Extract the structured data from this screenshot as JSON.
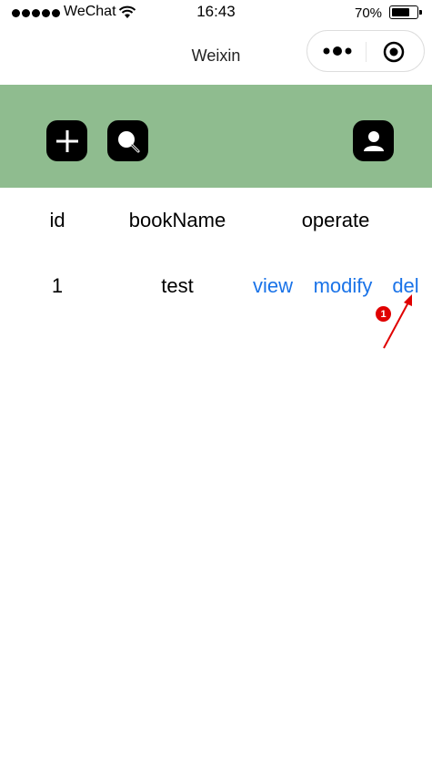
{
  "status_bar": {
    "carrier": "WeChat",
    "time": "16:43",
    "battery_percent": "70%",
    "battery_level": 0.7
  },
  "nav": {
    "title": "Weixin",
    "more_icon": "more-dots-icon",
    "close_icon": "close-miniprogram-icon"
  },
  "toolbar": {
    "background": "#8fbc8f",
    "buttons": [
      {
        "icon": "plus-icon"
      },
      {
        "icon": "search-icon"
      },
      {
        "icon": "user-icon"
      }
    ]
  },
  "table": {
    "headers": [
      "id",
      "bookName",
      "operate"
    ],
    "rows": [
      {
        "id": "1",
        "bookName": "test",
        "actions": [
          "view",
          "modify",
          "del"
        ]
      }
    ],
    "link_color": "#1a73e8"
  },
  "annotation": {
    "badge": "1",
    "color": "#e00000"
  }
}
